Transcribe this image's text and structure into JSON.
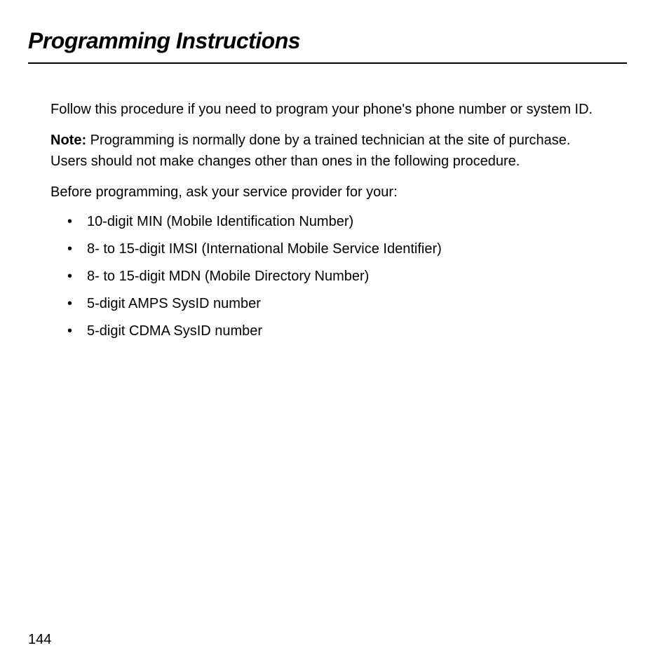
{
  "title": "Programming Instructions",
  "paragraphs": {
    "intro": "Follow this procedure if you need to program your phone's phone number or system ID.",
    "note_label": "Note:",
    "note_body": " Programming is normally done by a trained technician at the site of purchase. Users should not make changes other than ones in the following procedure.",
    "before": "Before programming, ask your service provider for your:"
  },
  "bullets": [
    "10-digit MIN (Mobile Identification Number)",
    "8- to 15-digit IMSI (International Mobile Service Identifier)",
    "8- to 15-digit MDN (Mobile Directory Number)",
    "5-digit AMPS SysID number",
    "5-digit CDMA SysID number"
  ],
  "page_number": "144"
}
